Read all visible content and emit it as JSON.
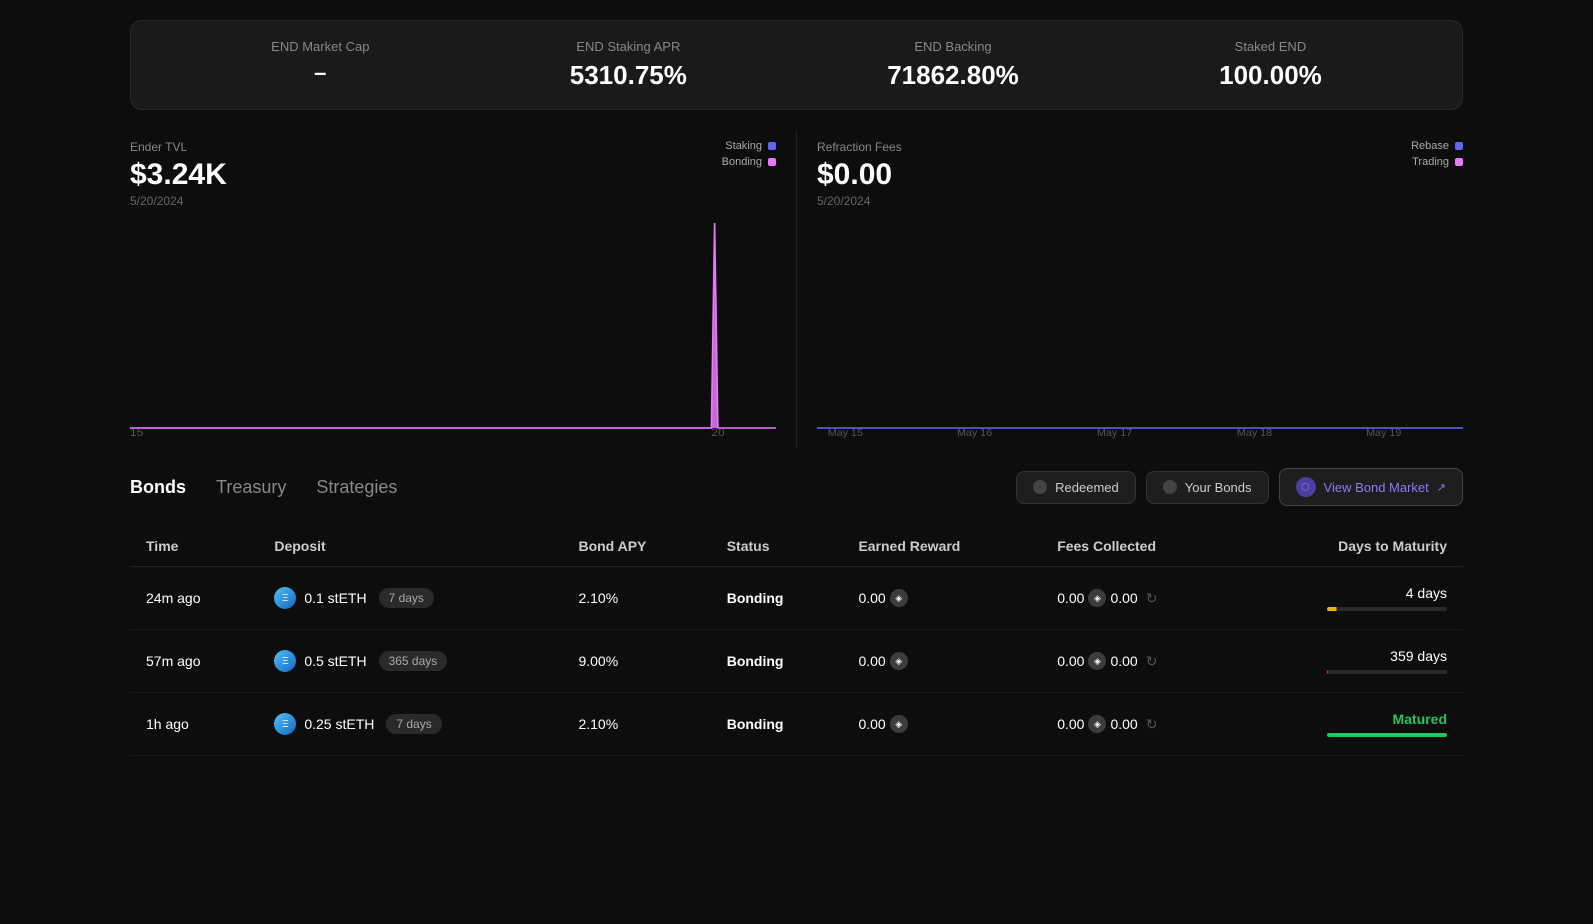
{
  "stats": {
    "items": [
      {
        "label": "END Market Cap",
        "value": "–"
      },
      {
        "label": "END Staking APR",
        "value": "5310.75%"
      },
      {
        "label": "END Backing",
        "value": "71862.80%"
      },
      {
        "label": "Staked END",
        "value": "100.00%"
      }
    ]
  },
  "tvl_chart": {
    "title": "Ender TVL",
    "value": "$3.24K",
    "date": "5/20/2024",
    "legend": [
      {
        "label": "Staking",
        "color": "#6366f1"
      },
      {
        "label": "Bonding",
        "color": "#e879f9"
      }
    ],
    "x_labels": [
      "15",
      "20"
    ]
  },
  "refraction_chart": {
    "title": "Refraction Fees",
    "value": "$0.00",
    "date": "5/20/2024",
    "legend": [
      {
        "label": "Rebase",
        "color": "#6366f1"
      },
      {
        "label": "Trading",
        "color": "#e879f9"
      }
    ],
    "x_labels": [
      "May 15",
      "May 16",
      "May 17",
      "May 18",
      "May 19"
    ]
  },
  "tabs": {
    "items": [
      {
        "label": "Bonds",
        "active": true
      },
      {
        "label": "Treasury",
        "active": false
      },
      {
        "label": "Strategies",
        "active": false
      }
    ],
    "actions": {
      "redeemed": "Redeemed",
      "your_bonds": "Your Bonds",
      "view_market": "View Bond Market"
    }
  },
  "table": {
    "headers": [
      "Time",
      "Deposit",
      "Bond APY",
      "Status",
      "Earned Reward",
      "Fees Collected",
      "Days to Maturity"
    ],
    "rows": [
      {
        "time": "24m ago",
        "deposit_amount": "0.1 stETH",
        "deposit_days": "7 days",
        "bond_apy": "2.10%",
        "status": "Bonding",
        "earned_reward": "0.00",
        "fees_collected_1": "0.00",
        "fees_collected_2": "0.00",
        "days_to_maturity": "4 days",
        "maturity_type": "yellow"
      },
      {
        "time": "57m ago",
        "deposit_amount": "0.5 stETH",
        "deposit_days": "365 days",
        "bond_apy": "9.00%",
        "status": "Bonding",
        "earned_reward": "0.00",
        "fees_collected_1": "0.00",
        "fees_collected_2": "0.00",
        "days_to_maturity": "359 days",
        "maturity_type": "dot"
      },
      {
        "time": "1h ago",
        "deposit_amount": "0.25 stETH",
        "deposit_days": "7 days",
        "bond_apy": "2.10%",
        "status": "Bonding",
        "earned_reward": "0.00",
        "fees_collected_1": "0.00",
        "fees_collected_2": "0.00",
        "days_to_maturity": "Matured",
        "maturity_type": "full-green"
      }
    ]
  }
}
